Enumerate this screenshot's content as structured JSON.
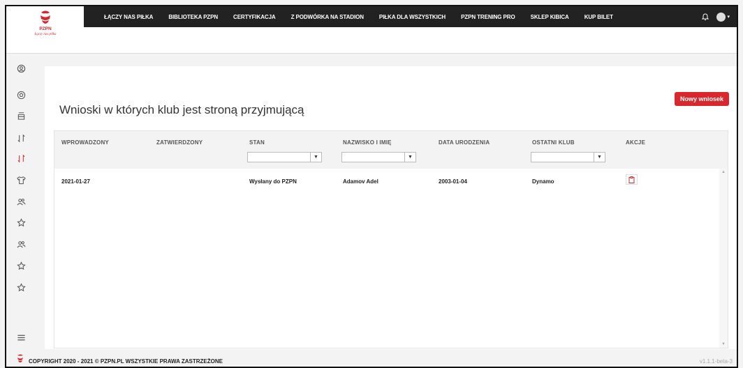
{
  "brand": {
    "name": "PZPN",
    "tagline": "Łączy nas piłka"
  },
  "nav": {
    "items": [
      "ŁĄCZY NAS PIŁKA",
      "BIBLIOTEKA PZPN",
      "CERTYFIKACJA",
      "Z PODWÓRKA NA STADION",
      "PIŁKA DLA WSZYSTKICH",
      "PZPN TRENING PRO",
      "SKLEP KIBICA",
      "KUP BILET"
    ]
  },
  "sidebar": {
    "icons": [
      "user-circle-icon",
      "football-icon",
      "inbox-icon",
      "sort-arrows-icon",
      "sort-arrows-active-icon",
      "shirt-icon",
      "users-icon",
      "star-icon",
      "users-icon",
      "star-icon",
      "star-icon",
      "menu-icon"
    ]
  },
  "page": {
    "title": "Wnioski w których klub jest stroną przyjmującą",
    "new_button": "Nowy wniosek"
  },
  "table": {
    "columns": [
      "WPROWADZONY",
      "ZATWIERDZONY",
      "STAN",
      "NAZWISKO I IMIĘ",
      "DATA URODZENIA",
      "OSTATNI KLUB",
      "AKCJE"
    ],
    "filters": {
      "stan": "",
      "nazwisko": "",
      "klub": ""
    },
    "rows": [
      {
        "wprowadzony": "2021-01-27",
        "zatwierdzony": "",
        "stan": "Wysłany do PZPN",
        "nazwisko": "Adamov Adel",
        "data_urodzenia": "2003-01-04",
        "ostatni_klub": "Dynamo"
      }
    ]
  },
  "footer": {
    "copyright": "COPYRIGHT 2020 - 2021 © PZPN.PL WSZYSTKIE PRAWA ZASTRZEŻONE",
    "version": "v1.1.1-beta-3"
  },
  "colors": {
    "accent": "#d9272e",
    "topbar": "#222222"
  }
}
